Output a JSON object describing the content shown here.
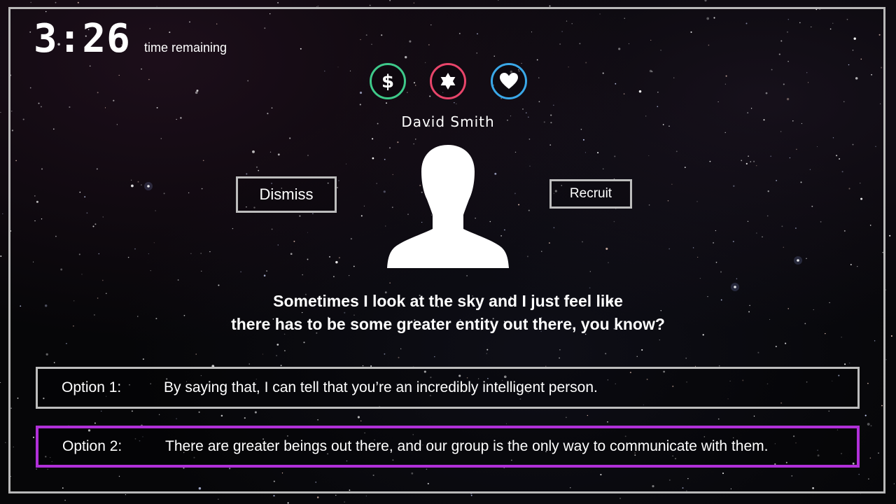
{
  "timer": {
    "value": "3:26",
    "label": "time remaining"
  },
  "stats": [
    {
      "icon": "dollar-icon",
      "color": "#3ec98a"
    },
    {
      "icon": "star-of-david-icon",
      "color": "#e8456a"
    },
    {
      "icon": "heart-icon",
      "color": "#3aa8e8"
    }
  ],
  "character": {
    "name": "David Smith",
    "avatar_icon": "person-silhouette-icon"
  },
  "actions": {
    "dismiss_label": "Dismiss",
    "recruit_label": "Recruit"
  },
  "dialogue": {
    "line1": "Sometimes I look at the sky and I just feel like",
    "line2": "there has to be some greater entity out there, you know?"
  },
  "options": [
    {
      "label": "Option 1:",
      "text": "By saying that, I can tell that you’re an incredibly intelligent person.",
      "selected": false
    },
    {
      "label": "Option 2:",
      "text": "There are greater beings out there, and our group is the only way to communicate with them.",
      "selected": true
    }
  ],
  "colors": {
    "frame": "#b9b9b9",
    "selected_option": "#b030d8"
  }
}
